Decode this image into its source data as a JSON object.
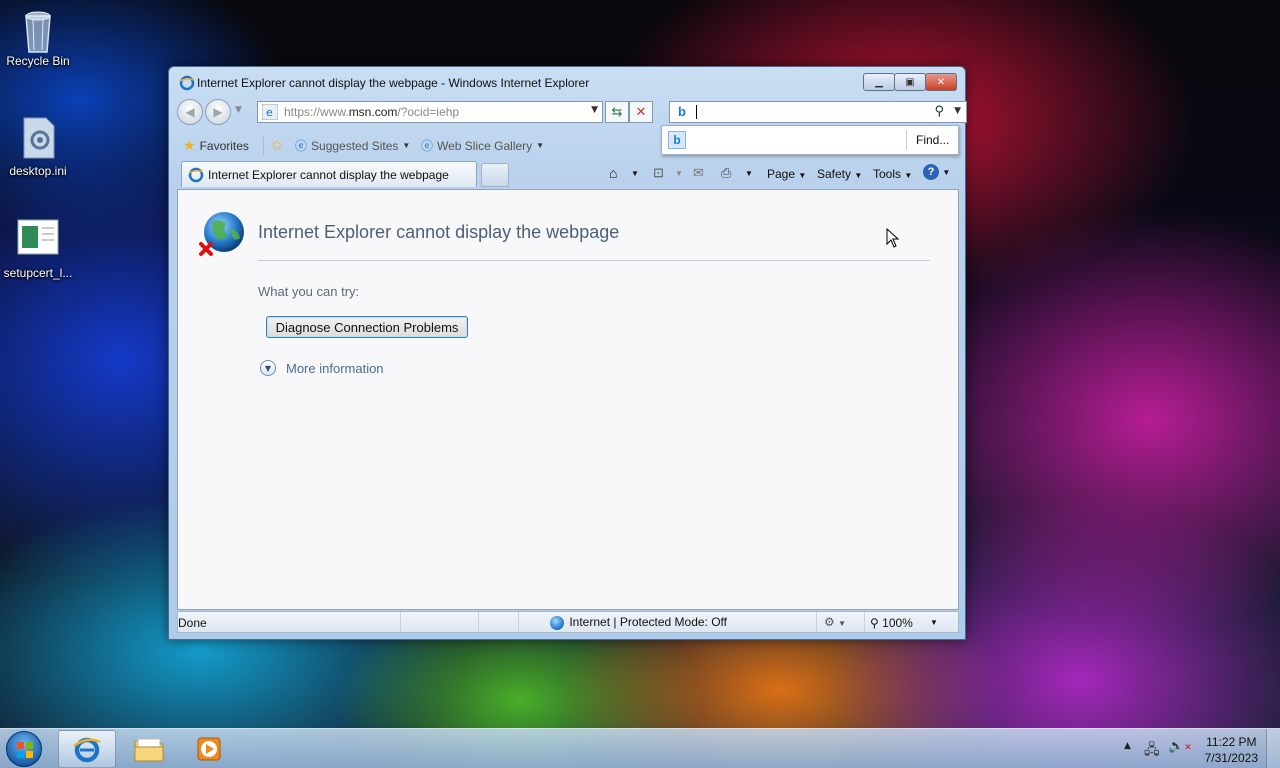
{
  "desktop": {
    "icons": [
      {
        "label": "Recycle Bin"
      },
      {
        "label": "desktop.ini"
      },
      {
        "label": "setupcert_l..."
      }
    ]
  },
  "window": {
    "title": "Internet Explorer cannot display the webpage - Windows Internet Explorer",
    "address": {
      "prefix": "https://www.",
      "domain": "msn.com",
      "suffix": "/?ocid=iehp"
    },
    "search": {
      "value": "",
      "find_label": "Find..."
    },
    "favorites_bar": {
      "favorites_label": "Favorites",
      "items": [
        {
          "label": "Suggested Sites"
        },
        {
          "label": "Web Slice Gallery"
        }
      ]
    },
    "tab": {
      "label": "Internet Explorer cannot display the webpage"
    },
    "command_bar": {
      "page": "Page",
      "safety": "Safety",
      "tools": "Tools"
    },
    "content": {
      "error_title": "Internet Explorer cannot display the webpage",
      "try_label": "What you can try:",
      "diagnose_button": "Diagnose Connection Problems",
      "more_info": "More information"
    },
    "status": {
      "text": "Done",
      "zone": "Internet | Protected Mode: Off",
      "zoom": "100%"
    }
  },
  "taskbar": {
    "clock_time": "11:22 PM",
    "clock_date": "7/31/2023"
  },
  "colors": {
    "accent": "#1d5fa8",
    "error_title": "#4a607a",
    "link": "#4a6c94"
  }
}
